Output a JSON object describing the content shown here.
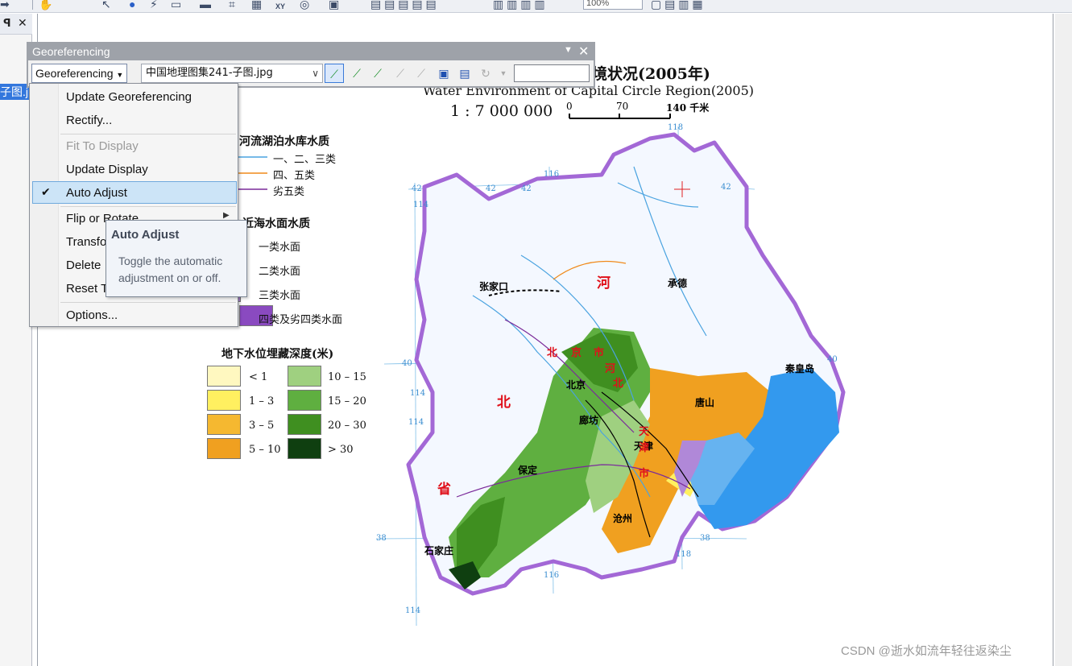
{
  "toolbar": {
    "zoom_value": "100%",
    "xy_label": "XY"
  },
  "toc": {
    "layer_name": "子图.jpg"
  },
  "georef_window": {
    "title": "Georeferencing",
    "menu_button": "Georeferencing",
    "layer_combo": "中国地理图集241-子图.jpg",
    "input_value": ""
  },
  "menu": {
    "items": [
      {
        "label": "Update Georeferencing",
        "enabled": true
      },
      {
        "label": "Rectify...",
        "enabled": true
      },
      {
        "label": "Fit To Display",
        "enabled": false
      },
      {
        "label": "Update Display",
        "enabled": true
      },
      {
        "label": "Auto Adjust",
        "enabled": true,
        "checked": true,
        "highlighted": true
      },
      {
        "label": "Flip or Rotate",
        "enabled": true,
        "submenu": true
      },
      {
        "label": "Transfo",
        "enabled": true
      },
      {
        "label": "Delete",
        "enabled": true
      },
      {
        "label": "Reset T",
        "enabled": true
      },
      {
        "label": "Options...",
        "enabled": true
      }
    ]
  },
  "tooltip": {
    "title": "Auto Adjust",
    "body": "Toggle the automatic adjustment on or off."
  },
  "map": {
    "title_cn": "境状况(2005年)",
    "title_en": "Water Environment of Capital Circle Region(2005)",
    "scale": "1 : 7 000 000",
    "scale_ticks": [
      "0",
      "70",
      "140 千米"
    ],
    "legend_rivers": {
      "heading": "河流湖泊水库水质",
      "items": [
        {
          "label": "一、二、三类",
          "color": "#4aa3e0"
        },
        {
          "label": "四、五类",
          "color": "#f08a1a"
        },
        {
          "label": "劣五类",
          "color": "#7a2a9a"
        }
      ]
    },
    "legend_sea": {
      "heading": "近海水面水质",
      "items": [
        {
          "label": "一类水面",
          "color": "#3399ee"
        },
        {
          "label": "二类水面",
          "color": "#66b3f0"
        },
        {
          "label": "三类水面",
          "color": "#b088d8"
        },
        {
          "label": "四类及劣四类水面",
          "color": "#8a4ac0"
        }
      ]
    },
    "legend_groundwater": {
      "heading": "地下水位埋藏深度(米)",
      "items": [
        {
          "label": "< 1",
          "color": "#fff8c0"
        },
        {
          "label": "1 – 3",
          "color": "#fff060"
        },
        {
          "label": "3 – 5",
          "color": "#f5b830"
        },
        {
          "label": "5 – 10",
          "color": "#f0a020"
        },
        {
          "label": "10 – 15",
          "color": "#9fd080"
        },
        {
          "label": "15 – 20",
          "color": "#5faf40"
        },
        {
          "label": "20 – 30",
          "color": "#3f8f20"
        },
        {
          "label": "> 30",
          "color": "#0f3f10"
        }
      ]
    },
    "cities": [
      "张家口",
      "承德",
      "秦皇岛",
      "北京",
      "唐山",
      "廊坊",
      "天津",
      "保定",
      "沧州",
      "石家庄"
    ],
    "provinces": [
      "河",
      "北",
      "省",
      "北",
      "京",
      "市",
      "天",
      "津",
      "市",
      "河",
      "北"
    ],
    "coords": [
      "42",
      "42",
      "42",
      "42",
      "114",
      "116",
      "118",
      "40",
      "40",
      "114",
      "114",
      "38",
      "38",
      "116",
      "118",
      "114"
    ]
  },
  "watermark": "CSDN @逝水如流年轻往返染尘"
}
